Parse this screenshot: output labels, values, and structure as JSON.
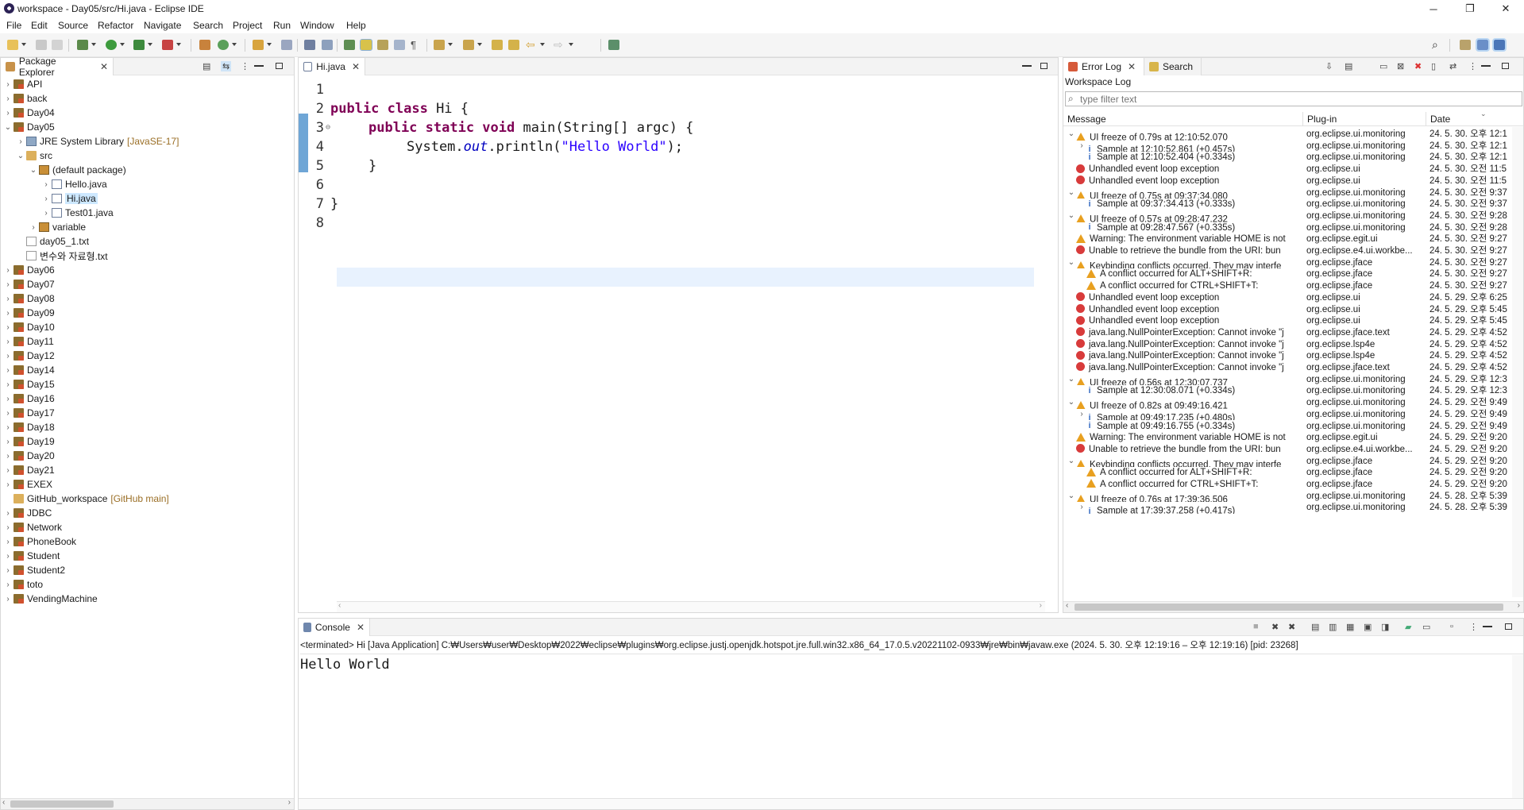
{
  "window": {
    "title": "workspace - Day05/src/Hi.java - Eclipse IDE",
    "controls": {
      "minimize": "─",
      "restore": "❐",
      "close": "✕"
    }
  },
  "menu": [
    "File",
    "Edit",
    "Source",
    "Refactor",
    "Navigate",
    "Search",
    "Project",
    "Run",
    "Window",
    "Help"
  ],
  "package_explorer": {
    "tab": "Package Explorer",
    "items": [
      {
        "label": "API",
        "type": "proj",
        "indent": 0,
        "twisty": "›"
      },
      {
        "label": "back",
        "type": "proj",
        "indent": 0,
        "twisty": "›"
      },
      {
        "label": "Day04",
        "type": "proj",
        "indent": 0,
        "twisty": "›"
      },
      {
        "label": "Day05",
        "type": "proj",
        "indent": 0,
        "twisty": "⌄"
      },
      {
        "label": "JRE System Library",
        "deco": "[JavaSE-17]",
        "type": "lib",
        "indent": 1,
        "twisty": "›"
      },
      {
        "label": "src",
        "type": "folder",
        "indent": 1,
        "twisty": "⌄"
      },
      {
        "label": "(default package)",
        "type": "pkg",
        "indent": 2,
        "twisty": "⌄"
      },
      {
        "label": "Hello.java",
        "type": "jfile",
        "indent": 3,
        "twisty": "›"
      },
      {
        "label": "Hi.java",
        "type": "jfile",
        "indent": 3,
        "twisty": "›",
        "selected": true
      },
      {
        "label": "Test01.java",
        "type": "jfile",
        "indent": 3,
        "twisty": "›"
      },
      {
        "label": "variable",
        "type": "pkg",
        "indent": 2,
        "twisty": "›"
      },
      {
        "label": "day05_1.txt",
        "type": "txt",
        "indent": 1,
        "twisty": ""
      },
      {
        "label": "변수와 자료형.txt",
        "type": "txt",
        "indent": 1,
        "twisty": ""
      },
      {
        "label": "Day06",
        "type": "proj",
        "indent": 0,
        "twisty": "›"
      },
      {
        "label": "Day07",
        "type": "proj",
        "indent": 0,
        "twisty": "›"
      },
      {
        "label": "Day08",
        "type": "proj",
        "indent": 0,
        "twisty": "›"
      },
      {
        "label": "Day09",
        "type": "proj",
        "indent": 0,
        "twisty": "›"
      },
      {
        "label": "Day10",
        "type": "proj",
        "indent": 0,
        "twisty": "›"
      },
      {
        "label": "Day11",
        "type": "proj",
        "indent": 0,
        "twisty": "›"
      },
      {
        "label": "Day12",
        "type": "proj",
        "indent": 0,
        "twisty": "›"
      },
      {
        "label": "Day14",
        "type": "proj",
        "indent": 0,
        "twisty": "›"
      },
      {
        "label": "Day15",
        "type": "proj",
        "indent": 0,
        "twisty": "›"
      },
      {
        "label": "Day16",
        "type": "proj",
        "indent": 0,
        "twisty": "›"
      },
      {
        "label": "Day17",
        "type": "proj",
        "indent": 0,
        "twisty": "›"
      },
      {
        "label": "Day18",
        "type": "proj",
        "indent": 0,
        "twisty": "›"
      },
      {
        "label": "Day19",
        "type": "proj",
        "indent": 0,
        "twisty": "›"
      },
      {
        "label": "Day20",
        "type": "proj",
        "indent": 0,
        "twisty": "›"
      },
      {
        "label": "Day21",
        "type": "proj",
        "indent": 0,
        "twisty": "›"
      },
      {
        "label": "EXEX",
        "type": "proj",
        "indent": 0,
        "twisty": "›"
      },
      {
        "label": "GitHub_workspace",
        "deco": "[GitHub main]",
        "type": "folder",
        "indent": 0,
        "twisty": ""
      },
      {
        "label": "JDBC",
        "type": "proj",
        "indent": 0,
        "twisty": "›"
      },
      {
        "label": "Network",
        "type": "proj",
        "indent": 0,
        "twisty": "›"
      },
      {
        "label": "PhoneBook",
        "type": "proj",
        "indent": 0,
        "twisty": "›"
      },
      {
        "label": "Student",
        "type": "proj",
        "indent": 0,
        "twisty": "›"
      },
      {
        "label": "Student2",
        "type": "proj",
        "indent": 0,
        "twisty": "›"
      },
      {
        "label": "toto",
        "type": "proj",
        "indent": 0,
        "twisty": "›"
      },
      {
        "label": "VendingMachine",
        "type": "proj",
        "indent": 0,
        "twisty": "›"
      }
    ]
  },
  "editor": {
    "tab": "Hi.java",
    "line_numbers": [
      "1",
      "2",
      "3",
      "4",
      "5",
      "6",
      "7",
      "8"
    ],
    "line3_marker": "⊖",
    "code": {
      "l2_kw": "public class",
      "l2_rest": " Hi {",
      "l3_kw": "public static void",
      "l3_rest": " main(String[] argc) {",
      "l4_pre": "System.",
      "l4_field": "out",
      "l4_mid": ".println(",
      "l4_str": "\"Hello World\"",
      "l4_end": ");",
      "l5": "}",
      "l7": "}"
    }
  },
  "error_log": {
    "tab_error": "Error Log",
    "tab_search": "Search",
    "subtitle": "Workspace Log",
    "filter_placeholder": "type filter text",
    "columns": {
      "message": "Message",
      "plugin": "Plug-in",
      "date": "Date"
    },
    "rows": [
      {
        "exp": "⌄",
        "icon": "warn",
        "indent": 0,
        "msg": "UI freeze of 0.79s at 12:10:52.070",
        "plugin": "org.eclipse.ui.monitoring",
        "date": "24. 5. 30. 오후 12:1"
      },
      {
        "exp": "›",
        "icon": "info",
        "indent": 1,
        "msg": "Sample at 12:10:52.861 (+0.457s)",
        "plugin": "org.eclipse.ui.monitoring",
        "date": "24. 5. 30. 오후 12:1"
      },
      {
        "exp": "",
        "icon": "info",
        "indent": 1,
        "msg": "Sample at 12:10:52.404 (+0.334s)",
        "plugin": "org.eclipse.ui.monitoring",
        "date": "24. 5. 30. 오후 12:1"
      },
      {
        "exp": "",
        "icon": "err",
        "indent": 0,
        "msg": "Unhandled event loop exception",
        "plugin": "org.eclipse.ui",
        "date": "24. 5. 30. 오전 11:5"
      },
      {
        "exp": "",
        "icon": "err",
        "indent": 0,
        "msg": "Unhandled event loop exception",
        "plugin": "org.eclipse.ui",
        "date": "24. 5. 30. 오전 11:5"
      },
      {
        "exp": "⌄",
        "icon": "warn",
        "indent": 0,
        "msg": "UI freeze of 0.75s at 09:37:34.080",
        "plugin": "org.eclipse.ui.monitoring",
        "date": "24. 5. 30. 오전 9:37"
      },
      {
        "exp": "",
        "icon": "info",
        "indent": 1,
        "msg": "Sample at 09:37:34.413 (+0.333s)",
        "plugin": "org.eclipse.ui.monitoring",
        "date": "24. 5. 30. 오전 9:37"
      },
      {
        "exp": "⌄",
        "icon": "warn",
        "indent": 0,
        "msg": "UI freeze of 0.57s at 09:28:47.232",
        "plugin": "org.eclipse.ui.monitoring",
        "date": "24. 5. 30. 오전 9:28"
      },
      {
        "exp": "",
        "icon": "info",
        "indent": 1,
        "msg": "Sample at 09:28:47.567 (+0.335s)",
        "plugin": "org.eclipse.ui.monitoring",
        "date": "24. 5. 30. 오전 9:28"
      },
      {
        "exp": "",
        "icon": "warn",
        "indent": 0,
        "msg": "Warning: The environment variable HOME is not",
        "plugin": "org.eclipse.egit.ui",
        "date": "24. 5. 30. 오전 9:27"
      },
      {
        "exp": "",
        "icon": "err",
        "indent": 0,
        "msg": "Unable to retrieve the bundle from the URI: bun",
        "plugin": "org.eclipse.e4.ui.workbe...",
        "date": "24. 5. 30. 오전 9:27"
      },
      {
        "exp": "⌄",
        "icon": "warn",
        "indent": 0,
        "msg": "Keybinding conflicts occurred.  They may interfe",
        "plugin": "org.eclipse.jface",
        "date": "24. 5. 30. 오전 9:27"
      },
      {
        "exp": "",
        "icon": "warn",
        "indent": 1,
        "msg": "A conflict occurred for ALT+SHIFT+R:",
        "plugin": "org.eclipse.jface",
        "date": "24. 5. 30. 오전 9:27"
      },
      {
        "exp": "",
        "icon": "warn",
        "indent": 1,
        "msg": "A conflict occurred for CTRL+SHIFT+T:",
        "plugin": "org.eclipse.jface",
        "date": "24. 5. 30. 오전 9:27"
      },
      {
        "exp": "",
        "icon": "err",
        "indent": 0,
        "msg": "Unhandled event loop exception",
        "plugin": "org.eclipse.ui",
        "date": "24. 5. 29. 오후 6:25"
      },
      {
        "exp": "",
        "icon": "err",
        "indent": 0,
        "msg": "Unhandled event loop exception",
        "plugin": "org.eclipse.ui",
        "date": "24. 5. 29. 오후 5:45"
      },
      {
        "exp": "",
        "icon": "err",
        "indent": 0,
        "msg": "Unhandled event loop exception",
        "plugin": "org.eclipse.ui",
        "date": "24. 5. 29. 오후 5:45"
      },
      {
        "exp": "",
        "icon": "err",
        "indent": 0,
        "msg": "java.lang.NullPointerException: Cannot invoke \"j",
        "plugin": "org.eclipse.jface.text",
        "date": "24. 5. 29. 오후 4:52"
      },
      {
        "exp": "",
        "icon": "err",
        "indent": 0,
        "msg": "java.lang.NullPointerException: Cannot invoke \"j",
        "plugin": "org.eclipse.lsp4e",
        "date": "24. 5. 29. 오후 4:52"
      },
      {
        "exp": "",
        "icon": "err",
        "indent": 0,
        "msg": "java.lang.NullPointerException: Cannot invoke \"j",
        "plugin": "org.eclipse.lsp4e",
        "date": "24. 5. 29. 오후 4:52"
      },
      {
        "exp": "",
        "icon": "err",
        "indent": 0,
        "msg": "java.lang.NullPointerException: Cannot invoke \"j",
        "plugin": "org.eclipse.jface.text",
        "date": "24. 5. 29. 오후 4:52"
      },
      {
        "exp": "⌄",
        "icon": "warn",
        "indent": 0,
        "msg": "UI freeze of 0.56s at 12:30:07.737",
        "plugin": "org.eclipse.ui.monitoring",
        "date": "24. 5. 29. 오후 12:3"
      },
      {
        "exp": "",
        "icon": "info",
        "indent": 1,
        "msg": "Sample at 12:30:08.071 (+0.334s)",
        "plugin": "org.eclipse.ui.monitoring",
        "date": "24. 5. 29. 오후 12:3"
      },
      {
        "exp": "⌄",
        "icon": "warn",
        "indent": 0,
        "msg": "UI freeze of 0.82s at 09:49:16.421",
        "plugin": "org.eclipse.ui.monitoring",
        "date": "24. 5. 29. 오전 9:49"
      },
      {
        "exp": "›",
        "icon": "info",
        "indent": 1,
        "msg": "Sample at 09:49:17.235 (+0.480s)",
        "plugin": "org.eclipse.ui.monitoring",
        "date": "24. 5. 29. 오전 9:49"
      },
      {
        "exp": "",
        "icon": "info",
        "indent": 1,
        "msg": "Sample at 09:49:16.755 (+0.334s)",
        "plugin": "org.eclipse.ui.monitoring",
        "date": "24. 5. 29. 오전 9:49"
      },
      {
        "exp": "",
        "icon": "warn",
        "indent": 0,
        "msg": "Warning: The environment variable HOME is not",
        "plugin": "org.eclipse.egit.ui",
        "date": "24. 5. 29. 오전 9:20"
      },
      {
        "exp": "",
        "icon": "err",
        "indent": 0,
        "msg": "Unable to retrieve the bundle from the URI: bun",
        "plugin": "org.eclipse.e4.ui.workbe...",
        "date": "24. 5. 29. 오전 9:20"
      },
      {
        "exp": "⌄",
        "icon": "warn",
        "indent": 0,
        "msg": "Keybinding conflicts occurred.  They may interfe",
        "plugin": "org.eclipse.jface",
        "date": "24. 5. 29. 오전 9:20"
      },
      {
        "exp": "",
        "icon": "warn",
        "indent": 1,
        "msg": "A conflict occurred for ALT+SHIFT+R:",
        "plugin": "org.eclipse.jface",
        "date": "24. 5. 29. 오전 9:20"
      },
      {
        "exp": "",
        "icon": "warn",
        "indent": 1,
        "msg": "A conflict occurred for CTRL+SHIFT+T:",
        "plugin": "org.eclipse.jface",
        "date": "24. 5. 29. 오전 9:20"
      },
      {
        "exp": "⌄",
        "icon": "warn",
        "indent": 0,
        "msg": "UI freeze of 0.76s at 17:39:36.506",
        "plugin": "org.eclipse.ui.monitoring",
        "date": "24. 5. 28. 오후 5:39"
      },
      {
        "exp": "›",
        "icon": "info",
        "indent": 1,
        "msg": "Sample at 17:39:37.258 (+0.417s)",
        "plugin": "org.eclipse.ui.monitoring",
        "date": "24. 5. 28. 오후 5:39"
      }
    ]
  },
  "console": {
    "tab": "Console",
    "status": "<terminated> Hi [Java Application] C:₩Users₩user₩Desktop₩2022₩eclipse₩plugins₩org.eclipse.justj.openjdk.hotspot.jre.full.win32.x86_64_17.0.5.v20221102-0933₩jre₩bin₩javaw.exe  (2024. 5. 30. 오후 12:19:16 – 오후 12:19:16) [pid: 23268]",
    "output": "Hello World"
  }
}
